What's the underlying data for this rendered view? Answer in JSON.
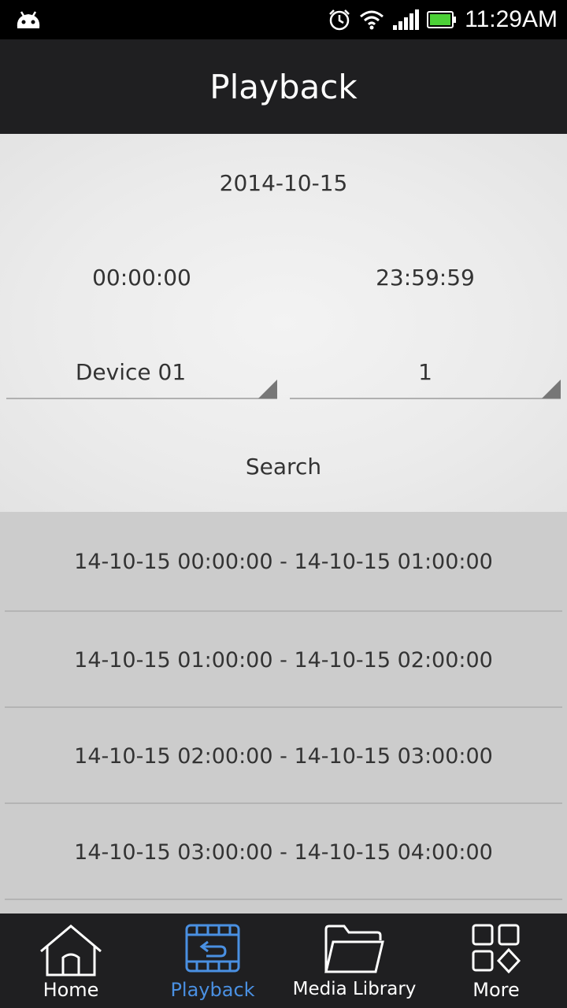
{
  "status_bar": {
    "time": "11:29AM",
    "icons": [
      "android-icon",
      "alarm-icon",
      "wifi-icon",
      "signal-icon",
      "battery-icon"
    ],
    "battery_color": "#4cd137"
  },
  "header": {
    "title": "Playback"
  },
  "search": {
    "date": "2014-10-15",
    "start_time": "00:00:00",
    "end_time": "23:59:59",
    "device": "Device 01",
    "channel": "1",
    "search_label": "Search"
  },
  "results": [
    "14-10-15 00:00:00 - 14-10-15 01:00:00",
    "14-10-15 01:00:00 - 14-10-15 02:00:00",
    "14-10-15 02:00:00 - 14-10-15 03:00:00",
    "14-10-15 03:00:00 - 14-10-15 04:00:00"
  ],
  "nav": {
    "home": "Home",
    "playback": "Playback",
    "media_library": "Media Library",
    "more": "More",
    "active_color": "#4a90e2"
  }
}
